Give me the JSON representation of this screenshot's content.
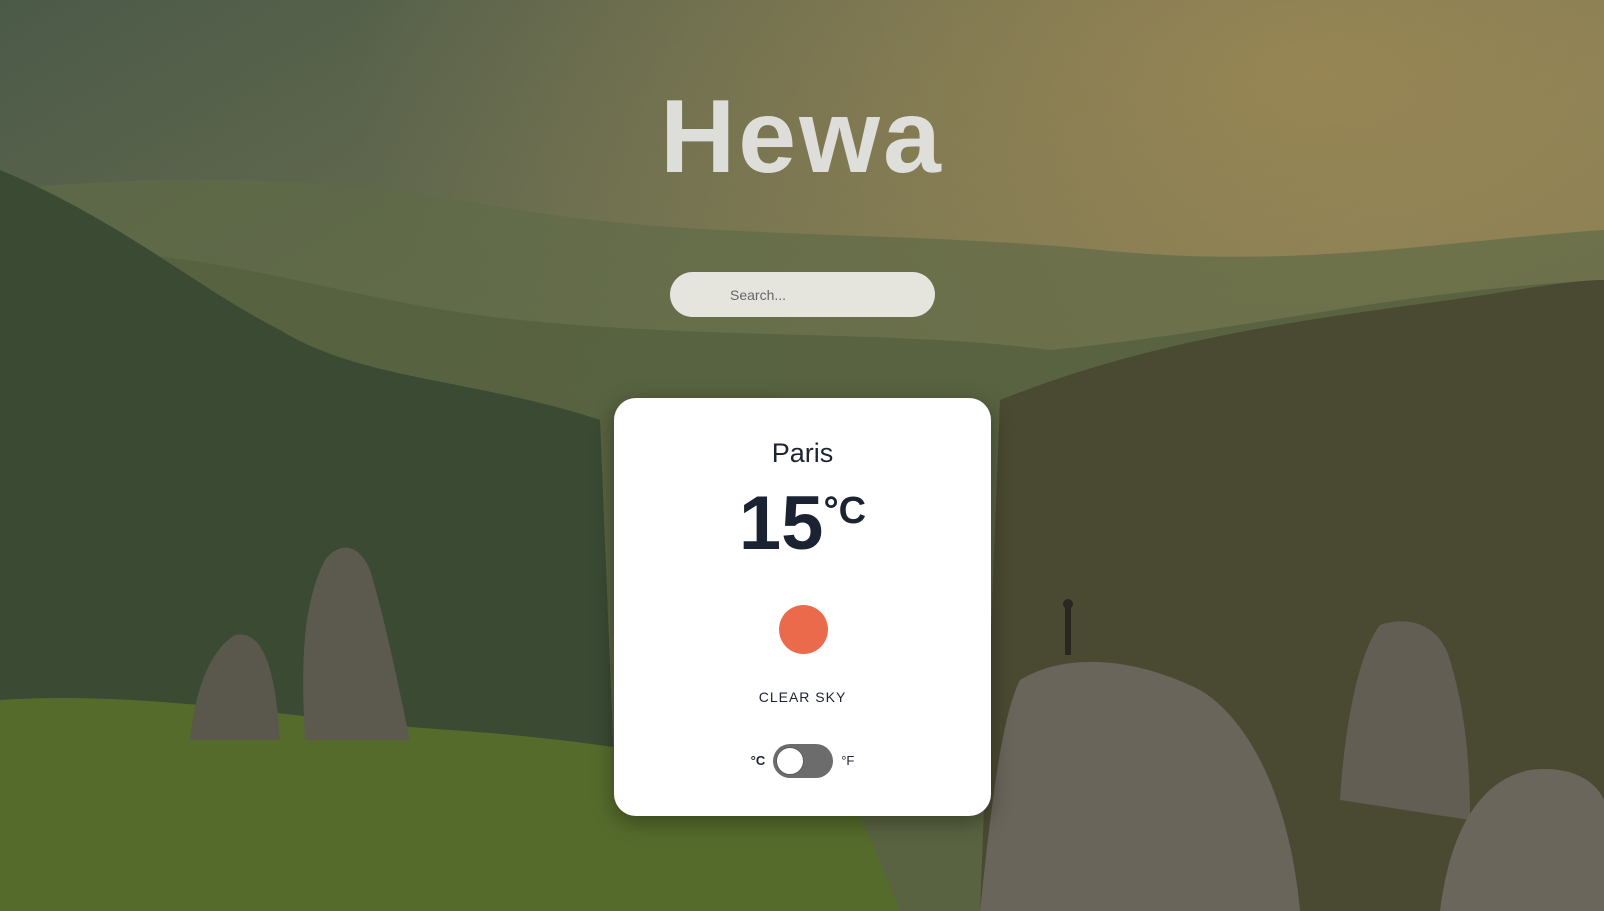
{
  "app": {
    "title": "Hewa"
  },
  "search": {
    "placeholder": "Search...",
    "value": ""
  },
  "weather": {
    "city": "Paris",
    "temperature": "15",
    "unit": "°C",
    "description": "CLEAR SKY",
    "icon": "sun-icon"
  },
  "unit_toggle": {
    "celsius_label": "°C",
    "fahrenheit_label": "°F",
    "selected": "°C"
  },
  "colors": {
    "sun": "#eb6a4b",
    "card": "#ffffff",
    "text_dark": "#1b2232",
    "toggle_track": "#6c6c6c"
  }
}
